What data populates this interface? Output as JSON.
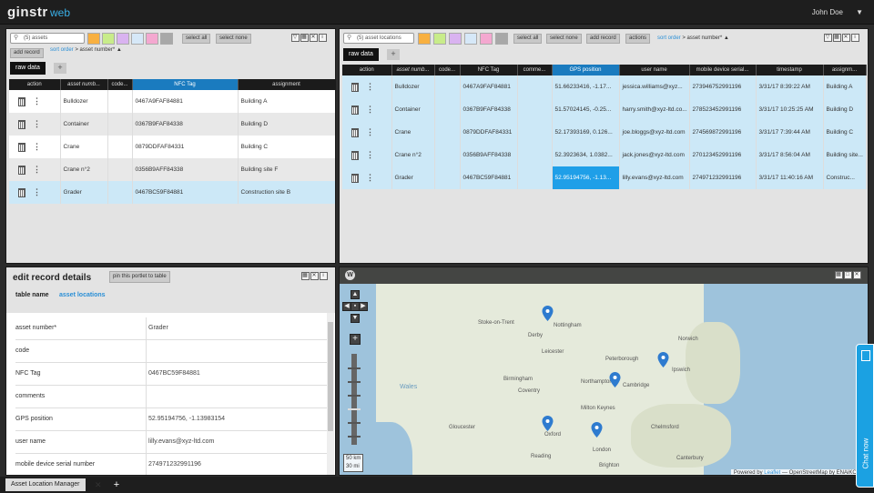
{
  "header": {
    "logo": "ginstr",
    "logo_web": "web",
    "user": "John Doe",
    "user_caret": "▼"
  },
  "colors": {
    "accent": "#1a7bbf",
    "selection": "#cce8f7",
    "link": "#2a8fd6",
    "chat": "#1ba1e2"
  },
  "swatch_colors": [
    "#f8b040",
    "#c8ec8a",
    "#d9b3f0",
    "#d6e8f8",
    "#f4a8d0",
    "#a8a8a8"
  ],
  "assets_portlet": {
    "search_placeholder": "(5) assets",
    "select_all": "select all",
    "select_none": "select none",
    "add_record": "add record",
    "sort_order_label": "sort order",
    "sort_order_value": " > asset number* ▲",
    "tab_label": "raw data",
    "tab_add": "+",
    "columns": [
      "action",
      "asset numb...",
      "code...",
      "NFC Tag",
      "assignment"
    ],
    "rows": [
      [
        "Bulldozer",
        "",
        "0467A9FAF84881",
        "Building A"
      ],
      [
        "Container",
        "",
        "0367B9FAF84338",
        "Building D"
      ],
      [
        "Crane",
        "",
        "0879DDFAF84331",
        "Building C"
      ],
      [
        "Crane n°2",
        "",
        "0356B9AFF84338",
        "Building site F"
      ],
      [
        "Grader",
        "",
        "0467BC59F84881",
        "Construction site B"
      ]
    ]
  },
  "locations_portlet": {
    "search_placeholder": "(5) asset locations",
    "select_all": "select all",
    "select_none": "select none",
    "add_record": "add record",
    "actions": "actions",
    "sort_order_label": "sort order",
    "sort_order_value": " > asset number* ▲",
    "tab_label": "raw data",
    "tab_add": "+",
    "columns": [
      "action",
      "asset numb...",
      "code...",
      "NFC Tag",
      "comme...",
      "GPS position",
      "user name",
      "mobile device serial...",
      "timestamp",
      "assignm..."
    ],
    "rows": [
      [
        "Bulldozer",
        "",
        "0467A9FAF84881",
        "",
        "51.66233416, -1.17...",
        "jessica.williams@xyz...",
        "273946752991196",
        "3/31/17 8:39:22 AM",
        "Building A"
      ],
      [
        "Container",
        "",
        "0367B9FAF84338",
        "",
        "51.57024145, -0.25...",
        "harry.smith@xyz-ltd.co...",
        "278523452991196",
        "3/31/17 10:25:25 AM",
        "Building D"
      ],
      [
        "Crane",
        "",
        "0879DDFAF84331",
        "",
        "52.17393169, 0.126...",
        "joe.bloggs@xyz-ltd.com",
        "274569872991196",
        "3/31/17 7:39:44 AM",
        "Building C"
      ],
      [
        "Crane n°2",
        "",
        "0356B9AFF84338",
        "",
        "52.3923634, 1.0382...",
        "jack.jones@xyz-ltd.com",
        "270123452991196",
        "3/31/17 8:56:04 AM",
        "Building site..."
      ],
      [
        "Grader",
        "",
        "0467BC59F84881",
        "",
        "52.95194756, -1.13...",
        "lilly.evans@xyz-ltd.com",
        "274971232991196",
        "3/31/17 11:40:16 AM",
        "Construc..."
      ]
    ]
  },
  "edit_portlet": {
    "title": "edit record details",
    "pin_button": "pin this portlet to table",
    "table_name_label": "table name",
    "table_name_value": "asset locations",
    "fields": [
      {
        "label": "asset number*",
        "value": "Grader"
      },
      {
        "label": "code",
        "value": ""
      },
      {
        "label": "NFC Tag",
        "value": "0467BC59F84881"
      },
      {
        "label": "comments",
        "value": ""
      },
      {
        "label": "GPS position",
        "value": "52.95194756, -1.13983154"
      },
      {
        "label": "user name",
        "value": "lilly.evans@xyz-ltd.com"
      },
      {
        "label": "mobile device serial number",
        "value": "274971232991196"
      }
    ]
  },
  "map": {
    "sea_label": "Wales",
    "cities": [
      "Nottingham",
      "Leicester",
      "Cambridge",
      "Oxford",
      "London",
      "Reading",
      "Northampton",
      "Milton Keynes",
      "Chelmsford",
      "Canterbury",
      "Brighton",
      "Norwich",
      "Ipswich",
      "Birmingham",
      "Coventry",
      "Peterborough",
      "Gloucester",
      "Stoke-on-Trent",
      "Derby"
    ],
    "scale_km": "50 km",
    "scale_mi": "30 mi",
    "attribution_prefix": "Powered by ",
    "attribution_link": "Leaflet",
    "attribution_rest": " — OpenStreetMap by ENAiKOON"
  },
  "bottom": {
    "tab_label": "Asset Location Manager",
    "tab_close": "✕",
    "add_tab": "+"
  },
  "chat": {
    "label": "Chat now"
  }
}
